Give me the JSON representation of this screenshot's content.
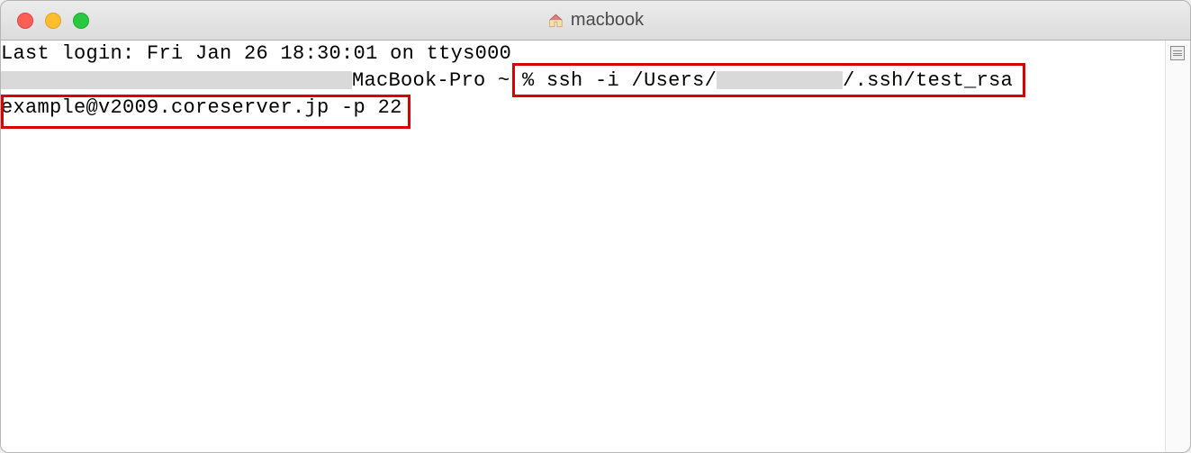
{
  "window": {
    "title": "macbook"
  },
  "terminal": {
    "line1": "Last login: Fri Jan 26 18:30:01 on ttys000",
    "prompt_prefix": "MacBook-Pro ~ % ",
    "ssh_part1": "ssh -i /Users/",
    "ssh_part2": "/.ssh/test_rsa",
    "line2": "example@v2009.coreserver.jp -p 22"
  }
}
